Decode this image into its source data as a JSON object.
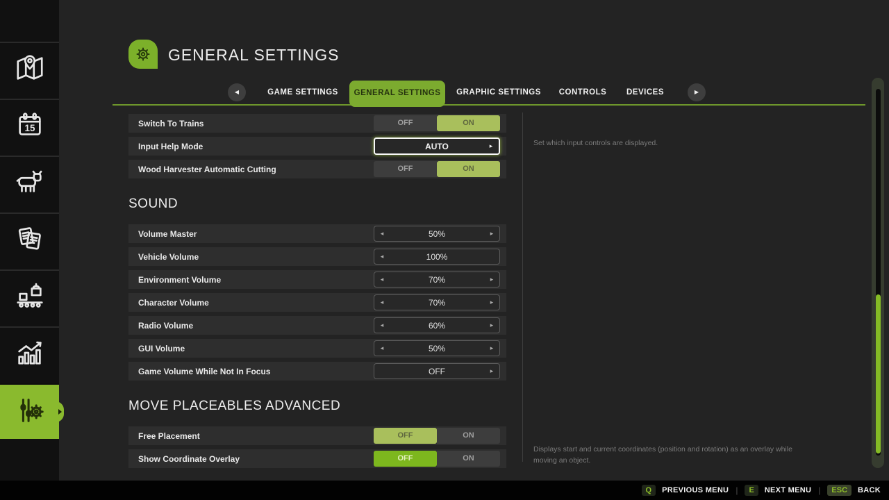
{
  "app": {
    "title": "GENERAL SETTINGS"
  },
  "colors": {
    "accent": "#7cab2f",
    "accent_bright": "#85bb25",
    "selected_muted": "#a9bf5c",
    "selected_vivid": "#7db71e",
    "sidebar_active": "#8aba2e"
  },
  "tabs": {
    "prev_icon": "chevron-left-icon",
    "next_icon": "chevron-right-icon",
    "items": [
      {
        "label": "GAME SETTINGS",
        "active": false
      },
      {
        "label": "GENERAL SETTINGS",
        "active": true
      },
      {
        "label": "GRAPHIC SETTINGS",
        "active": false
      },
      {
        "label": "CONTROLS",
        "active": false
      },
      {
        "label": "DEVICES",
        "active": false
      }
    ]
  },
  "sidebar": {
    "items": [
      {
        "icon": "map-icon",
        "active": false
      },
      {
        "icon": "calendar-icon",
        "active": false,
        "day": "15"
      },
      {
        "icon": "animals-icon",
        "active": false
      },
      {
        "icon": "contracts-icon",
        "active": false
      },
      {
        "icon": "production-icon",
        "active": false
      },
      {
        "icon": "statistics-icon",
        "active": false
      },
      {
        "icon": "settings-icon",
        "active": true
      }
    ]
  },
  "settings": {
    "rows": [
      {
        "type": "toggle",
        "label": "Switch To Trains",
        "options": [
          "OFF",
          "ON"
        ],
        "value": "ON",
        "selected_style": "muted"
      },
      {
        "type": "dropdown",
        "label": "Input Help Mode",
        "value": "AUTO",
        "focused": true
      },
      {
        "type": "toggle",
        "label": "Wood Harvester Automatic Cutting",
        "options": [
          "OFF",
          "ON"
        ],
        "value": "ON",
        "selected_style": "muted"
      },
      {
        "type": "section",
        "label": "SOUND"
      },
      {
        "type": "stepper",
        "label": "Volume Master",
        "value": "50%",
        "can_decrease": true,
        "can_increase": true
      },
      {
        "type": "stepper",
        "label": "Vehicle Volume",
        "value": "100%",
        "can_decrease": true,
        "can_increase": false
      },
      {
        "type": "stepper",
        "label": "Environment Volume",
        "value": "70%",
        "can_decrease": true,
        "can_increase": true
      },
      {
        "type": "stepper",
        "label": "Character Volume",
        "value": "70%",
        "can_decrease": true,
        "can_increase": true
      },
      {
        "type": "stepper",
        "label": "Radio Volume",
        "value": "60%",
        "can_decrease": true,
        "can_increase": true
      },
      {
        "type": "stepper",
        "label": "GUI Volume",
        "value": "50%",
        "can_decrease": true,
        "can_increase": true
      },
      {
        "type": "stepper",
        "label": "Game Volume While Not In Focus",
        "value": "OFF",
        "can_decrease": false,
        "can_increase": true
      },
      {
        "type": "section",
        "label": "MOVE PLACEABLES ADVANCED"
      },
      {
        "type": "toggle",
        "label": "Free Placement",
        "options": [
          "OFF",
          "ON"
        ],
        "value": "OFF",
        "selected_style": "muted"
      },
      {
        "type": "toggle",
        "label": "Show Coordinate Overlay",
        "options": [
          "OFF",
          "ON"
        ],
        "value": "OFF",
        "selected_style": "vivid"
      }
    ]
  },
  "tooltips": [
    {
      "text": "Set which input controls are displayed."
    },
    {
      "text": "Displays start and current coordinates (position and rotation) as an overlay while moving an object."
    }
  ],
  "footer": {
    "hints": [
      {
        "key": "Q",
        "label": "PREVIOUS MENU"
      },
      {
        "key": "E",
        "label": "NEXT MENU"
      },
      {
        "key": "ESC",
        "label": "BACK"
      }
    ]
  }
}
